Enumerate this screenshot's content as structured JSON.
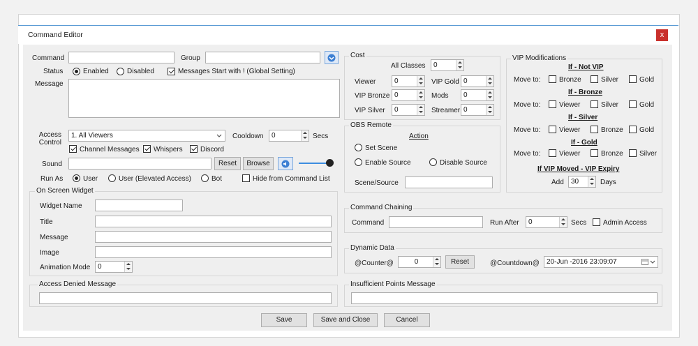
{
  "window": {
    "title": "Command Editor",
    "close": "x"
  },
  "command": {
    "label": "Command",
    "value": "",
    "group_label": "Group",
    "group_value": ""
  },
  "status": {
    "label": "Status",
    "enabled": "Enabled",
    "disabled": "Disabled",
    "messages_start": "Messages Start with ! (Global Setting)"
  },
  "message": {
    "label": "Message",
    "value": ""
  },
  "access": {
    "label": "Access Control",
    "selected": "1. All Viewers",
    "cooldown_label": "Cooldown",
    "cooldown_value": "0",
    "secs": "Secs",
    "channel": "Channel Messages",
    "whispers": "Whispers",
    "discord": "Discord"
  },
  "sound": {
    "label": "Sound",
    "value": "",
    "reset": "Reset",
    "browse": "Browse"
  },
  "runas": {
    "label": "Run As",
    "user": "User",
    "user_elevated": "User (Elevated Access)",
    "bot": "Bot",
    "hide": "Hide from Command List"
  },
  "widget": {
    "title": "On Screen Widget",
    "name_label": "Widget Name",
    "title_label": "Title",
    "message_label": "Message",
    "image_label": "Image",
    "anim_label": "Animation Mode",
    "anim_value": "0"
  },
  "access_denied": {
    "title": "Access Denied Message",
    "value": ""
  },
  "cost": {
    "title": "Cost",
    "all_classes": "All Classes",
    "all_value": "0",
    "viewer": "Viewer",
    "viewer_v": "0",
    "vip_bronze": "VIP Bronze",
    "vip_bronze_v": "0",
    "vip_silver": "VIP Silver",
    "vip_silver_v": "0",
    "vip_gold": "VIP Gold",
    "vip_gold_v": "0",
    "mods": "Mods",
    "mods_v": "0",
    "streamer": "Streamer",
    "streamer_v": "0"
  },
  "obs": {
    "title": "OBS Remote",
    "action": "Action",
    "set_scene": "Set Scene",
    "enable_source": "Enable Source",
    "disable_source": "Disable Source",
    "scene_source": "Scene/Source",
    "scene_value": ""
  },
  "vip": {
    "title": "VIP Modifications",
    "move_to": "Move to:",
    "h_not": "If - Not VIP",
    "h_bronze": "If - Bronze",
    "h_silver": "If - Silver",
    "h_gold": "If - Gold",
    "o_viewer": "Viewer",
    "o_bronze": "Bronze",
    "o_silver": "Silver",
    "o_gold": "Gold",
    "expiry": "If VIP Moved - VIP Expiry",
    "add": "Add",
    "days_value": "30",
    "days": "Days"
  },
  "chaining": {
    "title": "Command Chaining",
    "command": "Command",
    "value": "",
    "run_after": "Run After",
    "run_value": "0",
    "secs": "Secs",
    "admin": "Admin Access"
  },
  "dynamic": {
    "title": "Dynamic Data",
    "counter": "@Counter@",
    "counter_value": "0",
    "reset": "Reset",
    "countdown": "@Countdown@",
    "countdown_value": "20-Jun -2016  23:09:07"
  },
  "insufficient": {
    "title": "Insufficient Points Message",
    "value": ""
  },
  "footer": {
    "save": "Save",
    "save_close": "Save and Close",
    "cancel": "Cancel"
  },
  "colors": {
    "accent": "#5b9bd5",
    "close_bg": "#c9302c",
    "slider": "#3c8de0"
  }
}
